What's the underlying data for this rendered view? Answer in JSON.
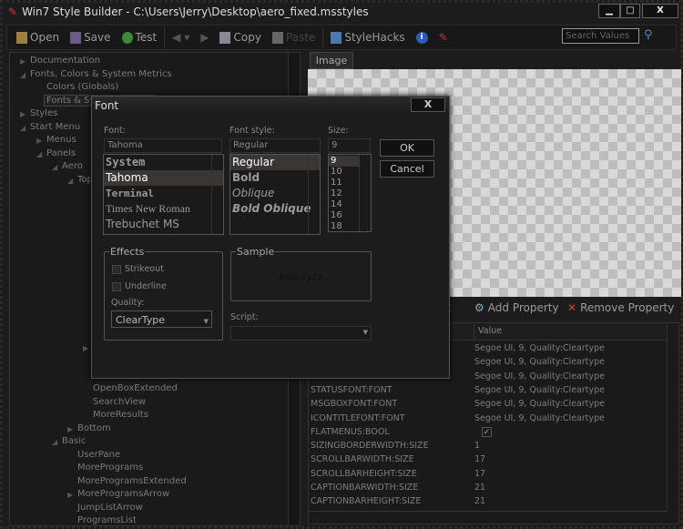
{
  "window": {
    "title": "Win7 Style Builder - C:\\Users\\Jerry\\Desktop\\aero_fixed.msstyles",
    "minimize": "▁",
    "maximize": "□",
    "close": "X"
  },
  "toolbar": {
    "open": "Open",
    "save": "Save",
    "test": "Test",
    "copy": "Copy",
    "paste": "Paste",
    "stylehacks": "StyleHacks",
    "search_placeholder": "Search Values"
  },
  "tree": {
    "items": [
      {
        "label": "Documentation"
      },
      {
        "label": "Fonts, Colors & System Metrics"
      },
      {
        "label": "Colors (Globals)"
      },
      {
        "label": "Fonts & System Metrics"
      },
      {
        "label": "Styles"
      },
      {
        "label": "Start Menu"
      },
      {
        "label": "Menus"
      },
      {
        "label": "Panels"
      },
      {
        "label": "Aero"
      },
      {
        "label": "Top"
      },
      {
        "label": "OpenBoxExtended"
      },
      {
        "label": "SearchView"
      },
      {
        "label": "MoreResults"
      },
      {
        "label": "Bottom"
      },
      {
        "label": "Basic"
      },
      {
        "label": "UserPane"
      },
      {
        "label": "MorePrograms"
      },
      {
        "label": "MoreProgramsExtended"
      },
      {
        "label": "MoreProgramsArrow"
      },
      {
        "label": "JumpListArrow"
      },
      {
        "label": "ProgramsList"
      }
    ]
  },
  "image_tab": "Image",
  "properties": {
    "export_partial": "ort",
    "add": "Add Property",
    "remove": "Remove Property",
    "value_header": "Value",
    "rows": [
      {
        "name": "",
        "value": "Segoe UI, 9, Quality:Cleartype"
      },
      {
        "name": "",
        "value": "Segoe UI, 9, Quality:Cleartype"
      },
      {
        "name": "",
        "value": "Segoe UI, 9, Quality:Cleartype"
      },
      {
        "name": "STATUSFONT:FONT",
        "value": "Segoe UI, 9, Quality:Cleartype"
      },
      {
        "name": "MSGBOXFONT:FONT",
        "value": "Segoe UI, 9, Quality:Cleartype"
      },
      {
        "name": "ICONTITLEFONT:FONT",
        "value": "Segoe UI, 9, Quality:Cleartype"
      },
      {
        "name": "FLATMENUS:BOOL",
        "value": "✓"
      },
      {
        "name": "SIZINGBORDERWIDTH:SIZE",
        "value": "1"
      },
      {
        "name": "SCROLLBARWIDTH:SIZE",
        "value": "17"
      },
      {
        "name": "SCROLLBARHEIGHT:SIZE",
        "value": "17"
      },
      {
        "name": "CAPTIONBARWIDTH:SIZE",
        "value": "21"
      },
      {
        "name": "CAPTIONBARHEIGHT:SIZE",
        "value": "21"
      }
    ]
  },
  "font_dialog": {
    "title": "Font",
    "close": "X",
    "font_label": "Font:",
    "font_value": "Tahoma",
    "fonts": [
      "System",
      "Tahoma",
      "Terminal",
      "Times New Roman",
      "Trebuchet MS"
    ],
    "style_label": "Font style:",
    "style_value": "Regular",
    "styles": [
      "Regular",
      "Bold",
      "Oblique",
      "Bold Oblique"
    ],
    "size_label": "Size:",
    "size_value": "9",
    "sizes": [
      "9",
      "10",
      "11",
      "12",
      "14",
      "16",
      "18"
    ],
    "ok": "OK",
    "cancel": "Cancel",
    "effects": "Effects",
    "strikeout": "Strikeout",
    "underline": "Underline",
    "quality_label": "Quality:",
    "quality_value": "ClearType",
    "sample": "Sample",
    "sample_text": "AaBbYyZz",
    "script_label": "Script:",
    "script_value": ""
  }
}
